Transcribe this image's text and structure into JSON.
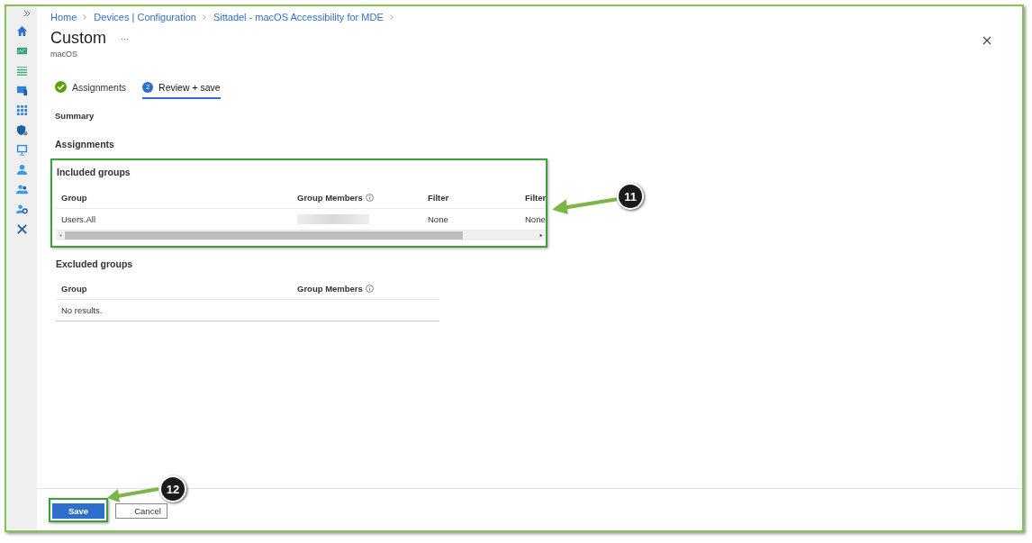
{
  "breadcrumb": [
    "Home",
    "Devices | Configuration",
    "Sittadel - macOS Accessibility for MDE"
  ],
  "page": {
    "title": "Custom",
    "more": "···",
    "subtitle": "macOS"
  },
  "steps": [
    {
      "label": "Assignments",
      "completed": true,
      "selected": false
    },
    {
      "label": "Review + save",
      "number": "2",
      "completed": false,
      "selected": true
    }
  ],
  "summary_label": "Summary",
  "section_title": "Assignments",
  "included_groups": {
    "title": "Included groups",
    "highlighted": true,
    "columns": [
      {
        "label": "Group",
        "info": false
      },
      {
        "label": "Group Members",
        "info": true
      },
      {
        "label": "Filter",
        "info": false
      },
      {
        "label": "Filter"
      }
    ],
    "rows": [
      [
        "Users.All",
        "",
        "None",
        "None"
      ]
    ],
    "redacted": [
      false,
      true,
      false,
      false
    ]
  },
  "excluded_groups": {
    "title": "Excluded groups",
    "columns": [
      {
        "label": "Group",
        "info": false
      },
      {
        "label": "Group Members",
        "info": true
      }
    ],
    "empty": "No results."
  },
  "callouts": [
    {
      "number": "11"
    },
    {
      "number": "12"
    }
  ],
  "buttons": [
    {
      "label": "Save",
      "primary": true,
      "highlighted": true
    },
    {
      "label": "Cancel",
      "primary": false,
      "highlighted": false
    }
  ]
}
